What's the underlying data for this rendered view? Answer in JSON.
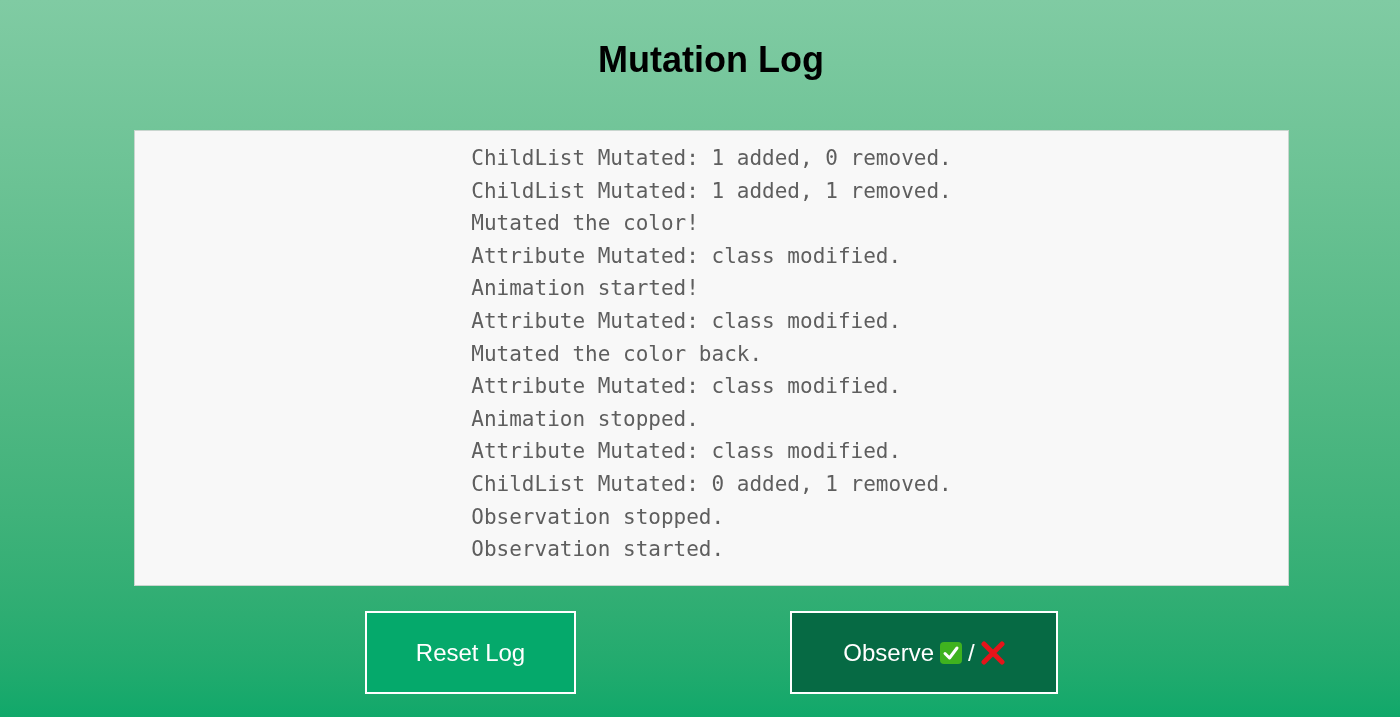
{
  "title": "Mutation Log",
  "log": {
    "lines": [
      "ChildList Mutated: 1 added, 0 removed.",
      "ChildList Mutated: 1 added, 1 removed.",
      "Mutated the color!",
      "Attribute Mutated: class modified.",
      "Animation started!",
      "Attribute Mutated: class modified.",
      "Mutated the color back.",
      "Attribute Mutated: class modified.",
      "Animation stopped.",
      "Attribute Mutated: class modified.",
      "ChildList Mutated: 0 added, 1 removed.",
      "Observation stopped.",
      "Observation started."
    ]
  },
  "buttons": [
    {
      "kind": "reset",
      "label": "Reset Log"
    },
    {
      "kind": "observe",
      "label": "Observe",
      "separator": "/"
    }
  ]
}
